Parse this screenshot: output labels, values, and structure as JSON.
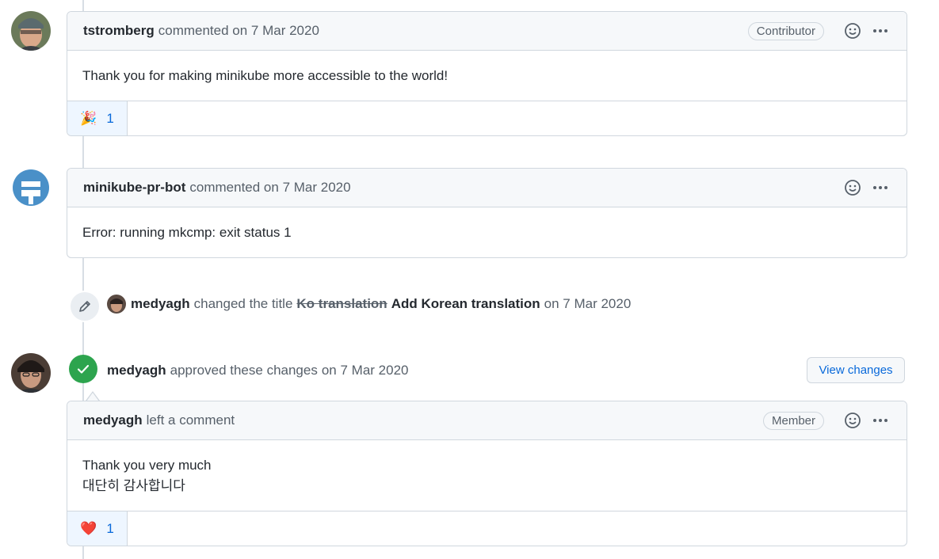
{
  "comments": [
    {
      "author": "tstromberg",
      "meta": "commented on 7 Mar 2020",
      "badge": "Contributor",
      "body": [
        "Thank you for making minikube more accessible to the world!"
      ],
      "reaction": {
        "emoji": "🎉",
        "count": "1"
      }
    },
    {
      "author": "minikube-pr-bot",
      "meta": "commented on 7 Mar 2020",
      "body": [
        "Error: running mkcmp: exit status 1"
      ]
    }
  ],
  "rename_event": {
    "actor": "medyagh",
    "action": "changed the title",
    "old_title": "Ko translation",
    "new_title": "Add Korean translation",
    "date": "on 7 Mar 2020"
  },
  "review_event": {
    "actor": "medyagh",
    "action": "approved these changes",
    "date": "on 7 Mar 2020",
    "button": "View changes"
  },
  "review_comment": {
    "author": "medyagh",
    "meta": "left a comment",
    "badge": "Member",
    "body": [
      "Thank you very much",
      "대단히 감사합니다"
    ],
    "reaction": {
      "emoji": "❤️",
      "count": "1"
    }
  },
  "icons": {
    "smiley": "smiley-icon",
    "more": "kebab-horizontal-icon",
    "pencil": "pencil-icon",
    "check": "check-icon"
  },
  "colors": {
    "approved_green": "#2da44e",
    "link_blue": "#0969da",
    "border": "#d0d7de",
    "header_bg": "#f6f8fa"
  }
}
